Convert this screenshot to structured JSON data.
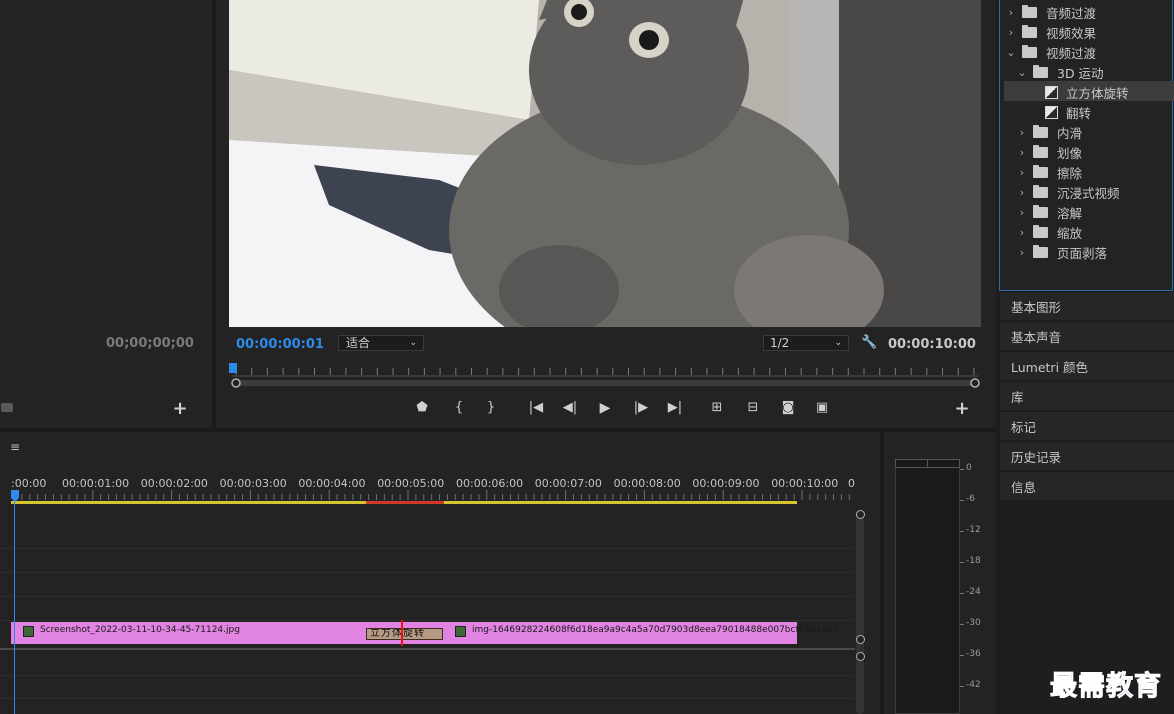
{
  "source_monitor": {
    "timecode": "00;00;00;00"
  },
  "program_monitor": {
    "current_time": "00:00:00:01",
    "fit_select": "适合",
    "resolution_select": "1/2",
    "duration": "00:00:10:00"
  },
  "transport": {
    "icons": [
      "marker-icon",
      "mark-in-icon",
      "mark-out-icon",
      "go-to-in-icon",
      "step-back-icon",
      "play-icon",
      "step-forward-icon",
      "go-to-out-icon",
      "lift-icon",
      "extract-icon",
      "export-frame-icon",
      "compare-icon",
      "add-button-icon"
    ]
  },
  "effects_tree": [
    {
      "label": "音频过渡",
      "level": 0,
      "type": "folder",
      "expanded": false
    },
    {
      "label": "视频效果",
      "level": 0,
      "type": "folder",
      "expanded": false
    },
    {
      "label": "视频过渡",
      "level": 0,
      "type": "folder",
      "expanded": true
    },
    {
      "label": "3D 运动",
      "level": 1,
      "type": "folder",
      "expanded": true
    },
    {
      "label": "立方体旋转",
      "level": 2,
      "type": "effect",
      "selected": true
    },
    {
      "label": "翻转",
      "level": 2,
      "type": "effect"
    },
    {
      "label": "内滑",
      "level": 1,
      "type": "folder",
      "expanded": false
    },
    {
      "label": "划像",
      "level": 1,
      "type": "folder",
      "expanded": false
    },
    {
      "label": "擦除",
      "level": 1,
      "type": "folder",
      "expanded": false
    },
    {
      "label": "沉浸式视频",
      "level": 1,
      "type": "folder",
      "expanded": false
    },
    {
      "label": "溶解",
      "level": 1,
      "type": "folder",
      "expanded": false
    },
    {
      "label": "缩放",
      "level": 1,
      "type": "folder",
      "expanded": false
    },
    {
      "label": "页面剥落",
      "level": 1,
      "type": "folder",
      "expanded": false
    }
  ],
  "side_panels": [
    "基本图形",
    "基本声音",
    "Lumetri 颜色",
    "库",
    "标记",
    "历史记录",
    "信息"
  ],
  "timeline": {
    "ruler": [
      ":00:00",
      "00:00:01:00",
      "00:00:02:00",
      "00:00:03:00",
      "00:00:04:00",
      "00:00:05:00",
      "00:00:06:00",
      "00:00:07:00",
      "00:00:08:00",
      "00:00:09:00",
      "00:00:10:00",
      "0"
    ],
    "clip1": "Screenshot_2022-03-11-10-34-45-71124.jpg",
    "clip2": "img-1646928224608f6d18ea9a9c4a5a70d7903d8eea79018488e007bcf6361a25",
    "transition_label": "立方体旋转",
    "colors": {
      "clip": "#e184e1",
      "playhead": "#2d8ceb",
      "transition": "#b79b84"
    }
  },
  "audio_meter": {
    "labels": [
      "0",
      "-6",
      "-12",
      "-18",
      "-24",
      "-30",
      "-36",
      "-42"
    ]
  },
  "watermark": "最需教育"
}
